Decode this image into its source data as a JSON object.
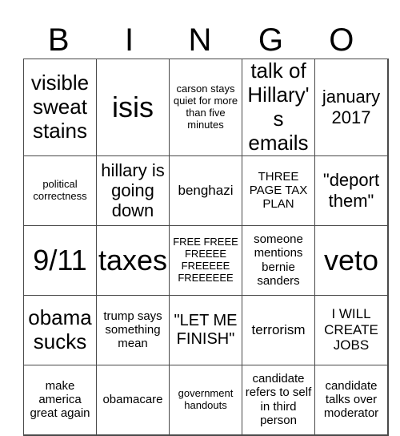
{
  "title_letters": [
    "B",
    "I",
    "N",
    "G",
    "O"
  ],
  "grid": [
    [
      {
        "text": "visible sweat stains",
        "size": "l"
      },
      {
        "text": "isis",
        "size": "xl"
      },
      {
        "text": "carson stays quiet for more than five minutes",
        "size": "xs"
      },
      {
        "text": "talk of Hillary's emails",
        "size": "l"
      },
      {
        "text": "january 2017",
        "size": "ml"
      }
    ],
    [
      {
        "text": "political correctness",
        "size": "xs"
      },
      {
        "text": "hillary is going down",
        "size": "ml"
      },
      {
        "text": "benghazi",
        "size": "sm"
      },
      {
        "text": "THREE PAGE TAX PLAN",
        "size": "s"
      },
      {
        "text": "\"deport them\"",
        "size": "ml"
      }
    ],
    [
      {
        "text": "9/11",
        "size": "xl"
      },
      {
        "text": "taxes",
        "size": "xl"
      },
      {
        "text": "FREE FREEE FREEEE FREEEEE FREEEEEE",
        "size": "xs"
      },
      {
        "text": "someone mentions bernie sanders",
        "size": "s"
      },
      {
        "text": "veto",
        "size": "xl"
      }
    ],
    [
      {
        "text": "obama sucks",
        "size": "l"
      },
      {
        "text": "trump says something mean",
        "size": "s"
      },
      {
        "text": "\"LET ME FINISH\"",
        "size": "m"
      },
      {
        "text": "terrorism",
        "size": "sm"
      },
      {
        "text": "I WILL CREATE JOBS",
        "size": "sm"
      }
    ],
    [
      {
        "text": "make america great again",
        "size": "s"
      },
      {
        "text": "obamacare",
        "size": "s"
      },
      {
        "text": "government handouts",
        "size": "xs"
      },
      {
        "text": "candidate refers to self in third person",
        "size": "s"
      },
      {
        "text": "candidate talks over moderator",
        "size": "s"
      }
    ]
  ]
}
